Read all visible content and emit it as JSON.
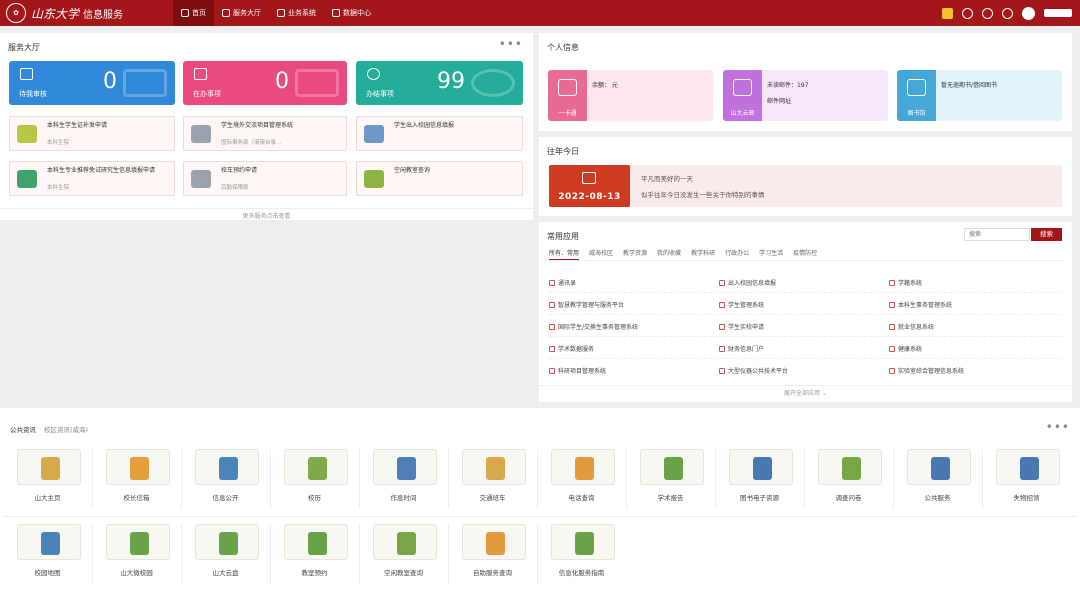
{
  "header": {
    "logo_text": "山东大学",
    "subtitle": "信息服务",
    "nav": [
      {
        "label": "首页",
        "active": true
      },
      {
        "label": "服务大厅",
        "active": false
      },
      {
        "label": "业务系统",
        "active": false
      },
      {
        "label": "数据中心",
        "active": false
      }
    ],
    "icons": [
      "edit-icon",
      "help-icon",
      "bell-icon",
      "gear-icon",
      "avatar"
    ]
  },
  "service_hall": {
    "title": "服务大厅",
    "more_label": "•••",
    "stats": [
      {
        "label": "待我审核",
        "value": "0",
        "color": "#2f89d8"
      },
      {
        "label": "在办事项",
        "value": "0",
        "color": "#ea4a82"
      },
      {
        "label": "办结事项",
        "value": "99",
        "color": "#23ad9a"
      }
    ],
    "services": [
      {
        "title": "本科生学生证补发申请",
        "sub": "本科生院",
        "color": "#b7c743"
      },
      {
        "title": "学生境外交流项目管理系统",
        "sub": "国际事务部（港澳台事…",
        "color": "#9aa2ad"
      },
      {
        "title": "学生出入校园信息填报",
        "sub": "",
        "color": "#6f97c9"
      },
      {
        "title": "本科生专业推荐免试研究生信息填报申请",
        "sub": "本科生院",
        "color": "#3fa36b"
      },
      {
        "title": "校车预约申请",
        "sub": "后勤保障部",
        "color": "#9aa2ad"
      },
      {
        "title": "空闲教室查询",
        "sub": "",
        "color": "#8eb446"
      }
    ],
    "more_services": "更多服务点击查看"
  },
  "personal": {
    "title": "个人信息",
    "cards": [
      {
        "caption": "一卡通",
        "line1": "余额：       元",
        "line2": "",
        "bg": "#fde6ee",
        "side": "#e96a94"
      },
      {
        "caption": "山大云邮",
        "line1": "未读邮件：197",
        "line2": "邮件网址",
        "bg": "#f7e6fb",
        "side": "#c171dd"
      },
      {
        "caption": "图书馆",
        "line1": "暂无逾期书/借阅图书",
        "line2": "",
        "bg": "#e3f3fb",
        "side": "#45a6d8"
      }
    ]
  },
  "history_today": {
    "title": "往年今日",
    "date": "2022-08-13",
    "line1": "平凡而美好的一天",
    "line2": "似乎往年今日没发生一些关于你特别的事情"
  },
  "apps": {
    "title": "常用应用",
    "search_placeholder": "搜索",
    "search_button": "搜索",
    "tabs": [
      "所有、常用",
      "威海校区",
      "教学资源",
      "我的收藏",
      "教学科研",
      "行政办公",
      "学习生活",
      "疫情防控"
    ],
    "items": [
      "通讯录",
      "出入校园信息填报",
      "学籍系统",
      "智慧教学管理与服务平台",
      "学生管理系统",
      "本科生事务管理系统",
      "国际学生/交换生事务管理系统",
      "学生实校申请",
      "就业信息系统",
      "学术数据服务",
      "财务信息门户",
      "健康系统",
      "科研项目管理系统",
      "大型仪器公共技术平台",
      "实验室综合管理信息系统"
    ],
    "expand": "展开全部应用 ⌄"
  },
  "news": {
    "tabs": [
      "公共资讯",
      "校区资讯(威海)"
    ],
    "more_label": "•••",
    "tiles": [
      {
        "label": "山大主页",
        "color": "#d8a94a"
      },
      {
        "label": "校长信箱",
        "color": "#e3a03c"
      },
      {
        "label": "信息公开",
        "color": "#4b84b6"
      },
      {
        "label": "校历",
        "color": "#7fa94a"
      },
      {
        "label": "作息时间",
        "color": "#4e7fb4"
      },
      {
        "label": "交通班车",
        "color": "#d8a94a"
      },
      {
        "label": "电话查询",
        "color": "#e39a3c"
      },
      {
        "label": "学术报告",
        "color": "#6aa248"
      },
      {
        "label": "图书电子资源",
        "color": "#4a78b0"
      },
      {
        "label": "调查问卷",
        "color": "#78a646"
      },
      {
        "label": "公共服务",
        "color": "#4a78b0"
      },
      {
        "label": "失物招领",
        "color": "#4a78b0"
      },
      {
        "label": "校园地图",
        "color": "#4a84b6"
      },
      {
        "label": "山大微校园",
        "color": "#6aa248"
      },
      {
        "label": "山大云盘",
        "color": "#6aa248"
      },
      {
        "label": "教室预约",
        "color": "#6aa248"
      },
      {
        "label": "空闲教室查询",
        "color": "#78a646"
      },
      {
        "label": "自助服务查询",
        "color": "#e39a3c"
      },
      {
        "label": "信息化服务指南",
        "color": "#6aa248"
      }
    ]
  }
}
